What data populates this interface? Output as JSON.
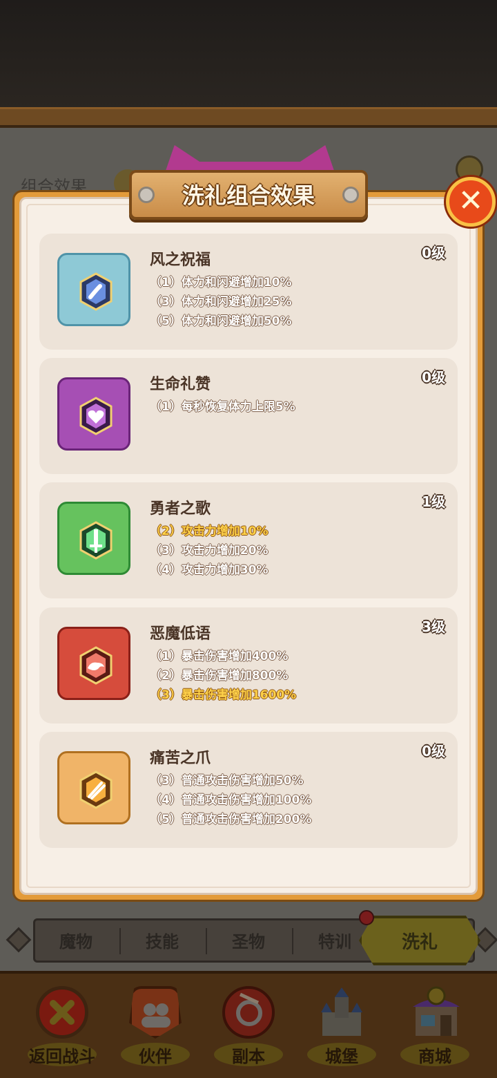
{
  "background": {
    "ghost_label": "组合效果"
  },
  "modal": {
    "title": "洗礼组合效果",
    "close_glyph": "✕",
    "cards": [
      {
        "title": "风之祝福",
        "level": "0级",
        "icon": "wind-blessing-icon",
        "color": "#8ec9d6",
        "lines": [
          {
            "text": "（1）体力和闪避增加10%",
            "active": false
          },
          {
            "text": "（3）体力和闪避增加25%",
            "active": false
          },
          {
            "text": "（5）体力和闪避增加50%",
            "active": false
          }
        ]
      },
      {
        "title": "生命礼赞",
        "level": "0级",
        "icon": "heart-icon",
        "color": "#a64fb4",
        "lines": [
          {
            "text": "（1）每秒恢复体力上限5%",
            "active": false
          }
        ]
      },
      {
        "title": "勇者之歌",
        "level": "1级",
        "icon": "sword-icon",
        "color": "#66c25e",
        "lines": [
          {
            "text": "（2）攻击力增加10%",
            "active": true
          },
          {
            "text": "（3）攻击力增加20%",
            "active": false
          },
          {
            "text": "（4）攻击力增加30%",
            "active": false
          }
        ]
      },
      {
        "title": "恶魔低语",
        "level": "3级",
        "icon": "demon-hand-icon",
        "color": "#d64c3c",
        "lines": [
          {
            "text": "（1）暴击伤害增加400%",
            "active": false
          },
          {
            "text": "（2）暴击伤害增加800%",
            "active": false
          },
          {
            "text": "（3）暴击伤害增加1600%",
            "active": true
          }
        ]
      },
      {
        "title": "痛苦之爪",
        "level": "0级",
        "icon": "claw-icon",
        "color": "#f0b468",
        "lines": [
          {
            "text": "（3）普通攻击伤害增加50%",
            "active": false
          },
          {
            "text": "（4）普通攻击伤害增加100%",
            "active": false
          },
          {
            "text": "（5）普通攻击伤害增加200%",
            "active": false
          }
        ]
      }
    ]
  },
  "tabs": {
    "items": [
      "魔物",
      "技能",
      "圣物",
      "特训"
    ],
    "active": "洗礼"
  },
  "bottom_nav": [
    {
      "label": "返回战斗",
      "icon": "return-battle-icon"
    },
    {
      "label": "伙伴",
      "icon": "partner-icon"
    },
    {
      "label": "副本",
      "icon": "dungeon-icon"
    },
    {
      "label": "城堡",
      "icon": "castle-icon"
    },
    {
      "label": "商城",
      "icon": "shop-icon"
    }
  ]
}
